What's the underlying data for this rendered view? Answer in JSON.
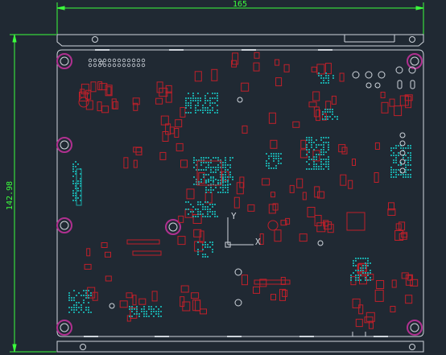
{
  "drawing": {
    "dim_width": "165",
    "dim_height": "142.98",
    "ucs_x": "X",
    "ucs_y": "Y"
  },
  "colors": {
    "background": "#202933",
    "outline": "#cfd5dc",
    "dimension": "#3cff3c",
    "component": "#c0202a",
    "pad": "#1aa6a6",
    "hole_ring": "#b03090"
  }
}
